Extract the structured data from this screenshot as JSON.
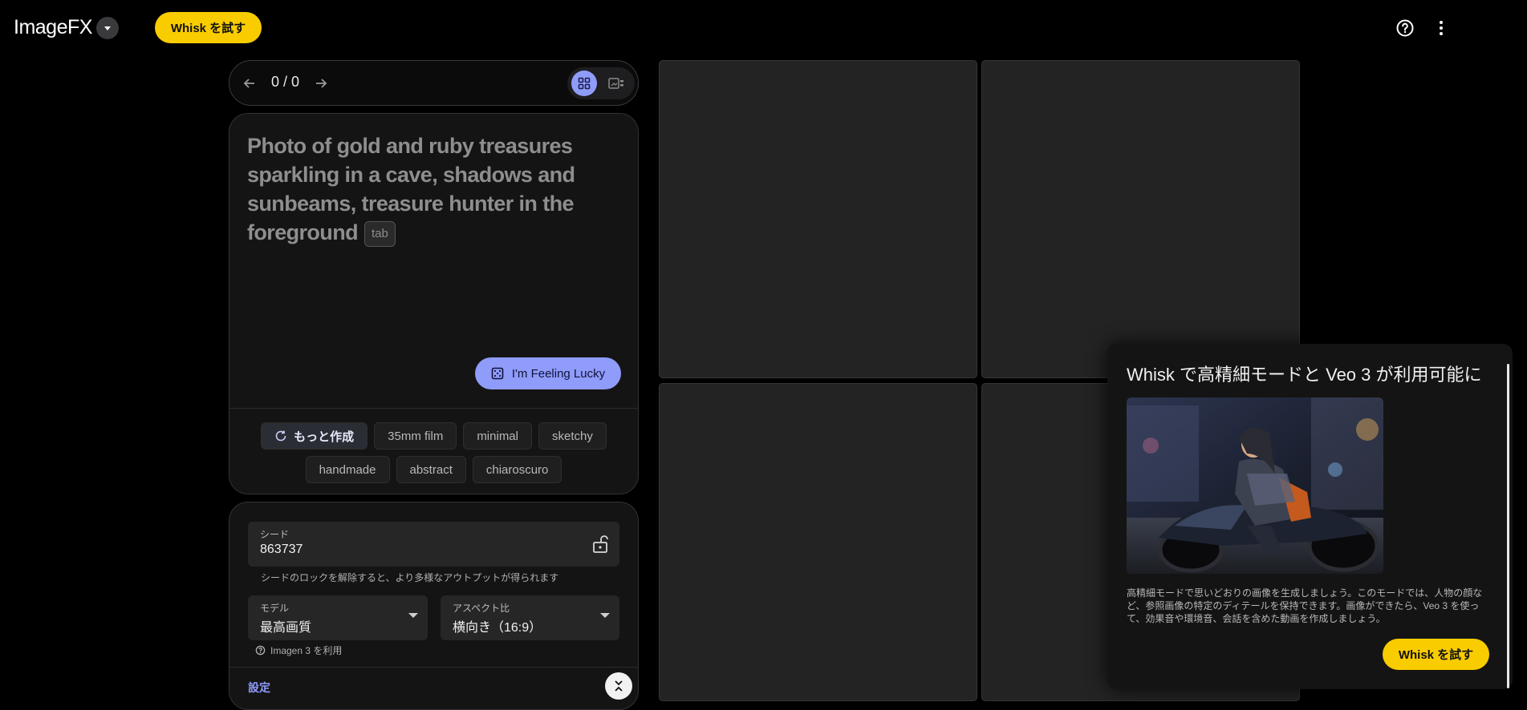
{
  "header": {
    "app_name": "ImageFX",
    "try_whisk_label": "Whisk を試す"
  },
  "pager": {
    "count": "0 / 0"
  },
  "prompt": {
    "placeholder": "Photo of gold and ruby treasures sparkling in a cave, shadows and sunbeams, treasure hunter in the foreground",
    "tab_hint": "tab",
    "lucky_label": "I'm Feeling Lucky",
    "chips_row1": [
      "もっと作成",
      "35mm film",
      "minimal",
      "sketchy"
    ],
    "chips_row2": [
      "handmade",
      "abstract",
      "chiaroscuro"
    ]
  },
  "settings": {
    "seed_label": "シード",
    "seed_value": "863737",
    "seed_hint": "シードのロックを解除すると、より多様なアウトプットが得られます",
    "model_label": "モデル",
    "model_value": "最高画質",
    "aspect_label": "アスペクト比",
    "aspect_value": "横向き（16:9）",
    "imagen_note": "Imagen 3 を利用",
    "settings_link": "設定"
  },
  "promo": {
    "title": "Whisk で高精細モードと Veo 3 が利用可能に",
    "body": "高精細モードで思いどおりの画像を生成しましょう。このモードでは、人物の顔など、参照画像の特定のディテールを保持できます。画像ができたら、Veo 3 を使って、効果音や環境音、会話を含めた動画を作成しましょう。",
    "button_label": "Whisk を試す"
  },
  "colors": {
    "accent": "#8f9cf9",
    "brand_yellow": "#f9cc00",
    "tile": "#232323"
  }
}
